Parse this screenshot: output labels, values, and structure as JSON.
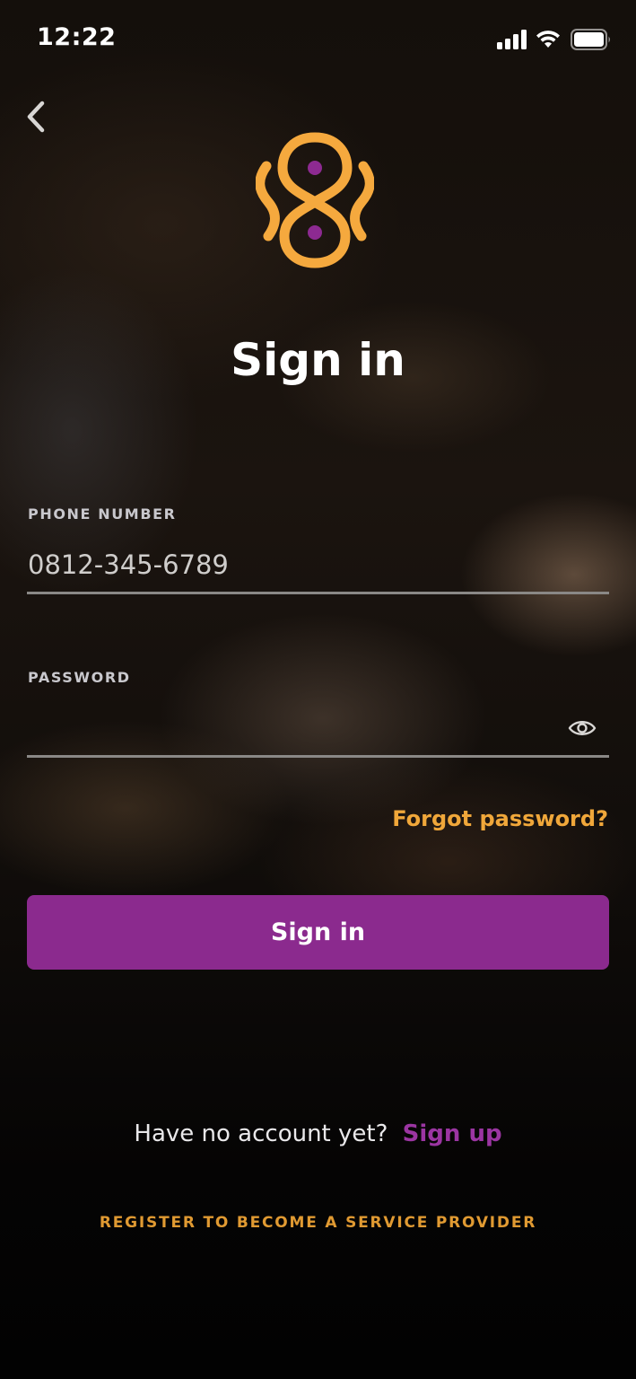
{
  "status_bar": {
    "time": "12:22",
    "icons": [
      "signal-icon",
      "wifi-icon",
      "battery-icon"
    ]
  },
  "header": {
    "back_icon": "chevron-left-icon",
    "logo": "brand-logo"
  },
  "title": "Sign in",
  "form": {
    "phone": {
      "label": "PHONE NUMBER",
      "placeholder": "0812-345-6789",
      "value": ""
    },
    "password": {
      "label": "PASSWORD",
      "value": "",
      "toggle_icon": "eye-icon"
    },
    "forgot_password": "Forgot password?",
    "submit_label": "Sign in"
  },
  "footer": {
    "signup_prompt": "Have no account yet?",
    "signup_link": "Sign up",
    "register_provider": "REGISTER TO BECOME A SERVICE PROVIDER"
  },
  "colors": {
    "accent_purple": "#8b2a8e",
    "accent_orange": "#f0a73a",
    "text_white": "#ffffff"
  }
}
